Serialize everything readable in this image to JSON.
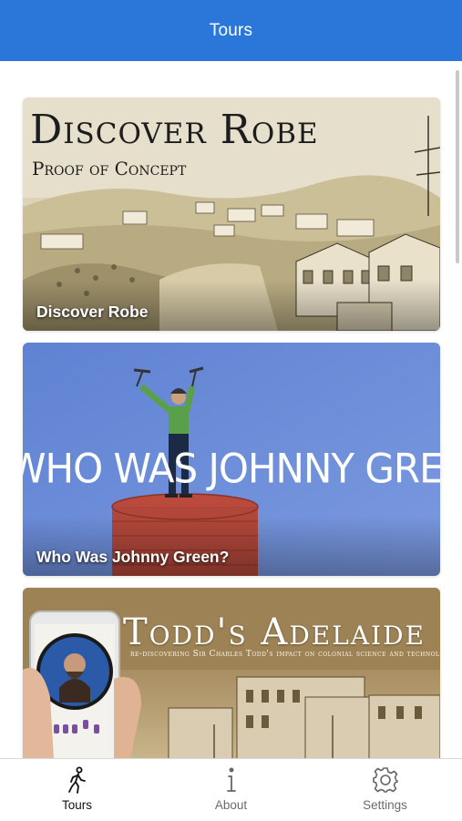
{
  "header": {
    "title": "Tours"
  },
  "tours": [
    {
      "label": "Discover Robe",
      "art_title": "Discover Robe",
      "art_subtitle": "Proof of Concept"
    },
    {
      "label": "Who Was Johnny Green?",
      "art_title": "WHO WAS JOHNNY GREEN?"
    },
    {
      "label": "",
      "art_title": "Todd's Adelaide",
      "art_subtitle": "re-discovering Sir Charles Todd's impact on colonial science and technology"
    }
  ],
  "tabbar": {
    "items": [
      {
        "label": "Tours",
        "icon": "walking-person-icon",
        "active": true
      },
      {
        "label": "About",
        "icon": "info-icon",
        "active": false
      },
      {
        "label": "Settings",
        "icon": "gear-icon",
        "active": false
      }
    ]
  },
  "colors": {
    "header_bg": "#2a77d9",
    "johnny_bg": "#6a8bd6",
    "active_tab": "#111111",
    "inactive_tab": "#6b6b6b"
  }
}
